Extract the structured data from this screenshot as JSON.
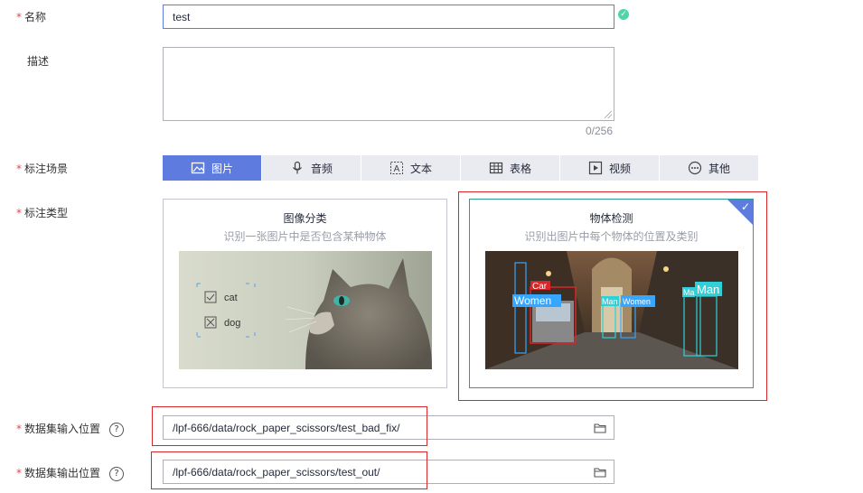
{
  "form": {
    "name": {
      "label": "名称",
      "value": "test"
    },
    "description": {
      "label": "描述",
      "value": "",
      "counter": "0/256"
    },
    "scene": {
      "label": "标注场景",
      "tabs": [
        {
          "label": "图片",
          "icon": "image-icon",
          "active": true
        },
        {
          "label": "音频",
          "icon": "microphone-icon",
          "active": false
        },
        {
          "label": "文本",
          "icon": "text-icon",
          "active": false
        },
        {
          "label": "表格",
          "icon": "table-icon",
          "active": false
        },
        {
          "label": "视频",
          "icon": "video-icon",
          "active": false
        },
        {
          "label": "其他",
          "icon": "more-icon",
          "active": false
        }
      ]
    },
    "type": {
      "label": "标注类型",
      "cards": [
        {
          "title": "图像分类",
          "desc": "识别一张图片中是否包含某种物体",
          "selected": false,
          "labels": [
            "cat",
            "dog"
          ]
        },
        {
          "title": "物体检测",
          "desc": "识别出图片中每个物体的位置及类别",
          "selected": true,
          "labels": [
            "Car",
            "Women",
            "Man",
            "Women",
            "Ma",
            "Man"
          ]
        }
      ]
    },
    "input_path": {
      "label": "数据集输入位置",
      "value": "/lpf-666/data/rock_paper_scissors/test_bad_fix/",
      "help": "?"
    },
    "output_path": {
      "label": "数据集输出位置",
      "value": "/lpf-666/data/rock_paper_scissors/test_out/",
      "help": "?"
    }
  },
  "colors": {
    "accent": "#5e7ce0",
    "required": "#e0474a",
    "highlight": "#d9262b",
    "selected_border": "#2e9a9a",
    "success": "#50d4ab"
  }
}
